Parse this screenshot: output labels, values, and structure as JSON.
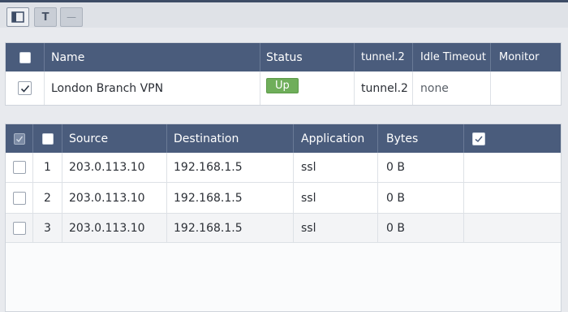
{
  "toolbar": {
    "buttons": [
      {
        "name": "panel-icon"
      },
      {
        "name": "text-icon",
        "label": "T"
      },
      {
        "name": "minus-icon",
        "label": "—"
      }
    ]
  },
  "tunnels": {
    "columns": [
      "Name",
      "Status",
      "tunnel.2",
      "Idle Timeout",
      "Monitor"
    ],
    "rows": [
      {
        "checked": true,
        "name": "London Branch VPN",
        "status": "Up",
        "tunnel": "tunnel.2",
        "idle_timeout": "none",
        "monitor": ""
      }
    ]
  },
  "sessions": {
    "columns": [
      "Source",
      "Destination",
      "Application",
      "Bytes"
    ],
    "rows": [
      {
        "index": "1",
        "source": "203.0.113.10",
        "destination": "192.168.1.5",
        "application": "ssl",
        "bytes": "0 B"
      },
      {
        "index": "2",
        "source": "203.0.113.10",
        "destination": "192.168.1.5",
        "application": "ssl",
        "bytes": "0 B"
      },
      {
        "index": "3",
        "source": "203.0.113.10",
        "destination": "192.168.1.5",
        "application": "ssl",
        "bytes": "0 B"
      }
    ]
  },
  "colors": {
    "header_bg": "#4a5c7c",
    "status_up": "#6fae5a",
    "toolbar_bar": "#3d4c66"
  }
}
